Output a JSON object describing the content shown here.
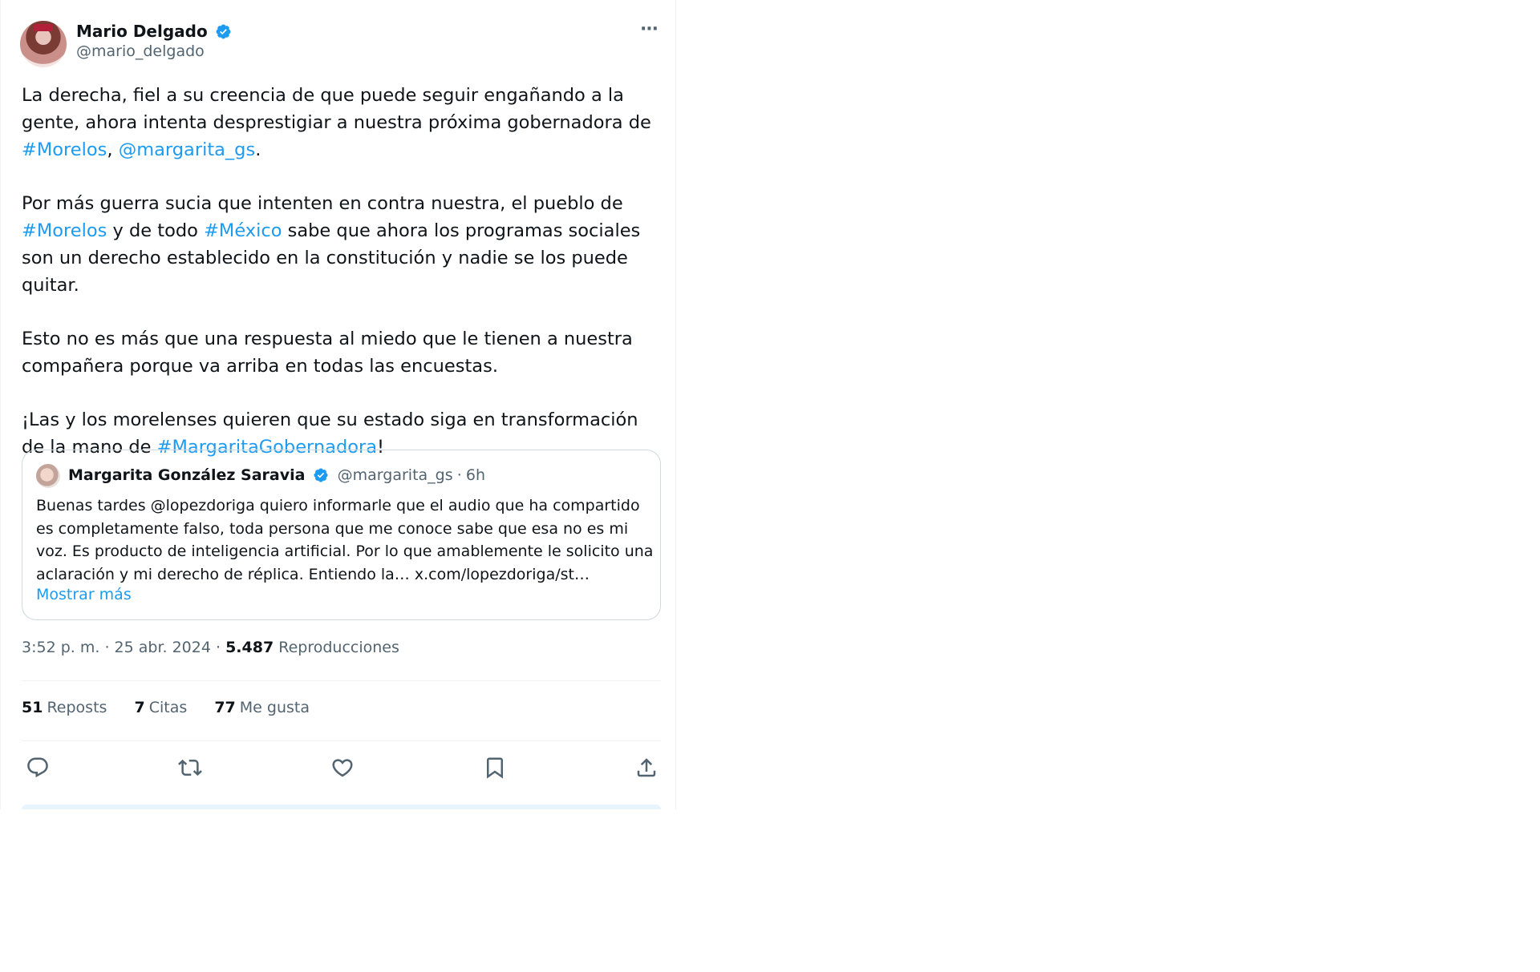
{
  "author": {
    "display_name": "Mario Delgado",
    "handle": "@mario_delgado",
    "verified": true
  },
  "menu": {
    "more_icon": "more-horizontal-icon",
    "more_glyph": "···"
  },
  "tweet": {
    "p1": {
      "t1": "La derecha, fiel a su creencia de que puede seguir engañando a la gente, ahora intenta desprestigiar a nuestra próxima gobernadora de ",
      "l1": "#Morelos",
      "t2": ", ",
      "l2": "@margarita_gs",
      "t3": "."
    },
    "p2": {
      "t1": "Por más guerra sucia que intenten en contra nuestra, el pueblo de ",
      "l1": "#Morelos",
      "t2": " y de todo ",
      "l2": "#México",
      "t3": " sabe que ahora los programas sociales son un derecho establecido en la constitución y nadie se los puede quitar."
    },
    "p3": {
      "t1": "Esto no es más que una respuesta al miedo que le tienen a nuestra compañera porque va arriba en todas las encuestas."
    },
    "p4": {
      "t1": "¡Las y los morelenses quieren que su estado siga en transformación de la mano de ",
      "l1": "#MargaritaGobernadora",
      "t2": "!"
    }
  },
  "quote": {
    "display_name": "Margarita González Saravia",
    "handle": "@margarita_gs",
    "separator": "·",
    "time": "6h",
    "text": "Buenas tardes @lopezdoriga quiero informarle que el audio que ha compartido es completamente falso, toda persona que me conoce sabe que esa no es mi voz. Es producto de inteligencia artificial. Por lo que amablemente le solicito una aclaración y mi derecho de réplica. Entiendo la… x.com/lopezdoriga/st…",
    "show_more": "Mostrar más"
  },
  "meta": {
    "time": "3:52 p. m.",
    "sep1": " · ",
    "date": "25 abr. 2024",
    "sep2": " · ",
    "views_count": "5.487",
    "views_label": " Reproducciones"
  },
  "stats": {
    "reposts_count": "51",
    "reposts_label": "Reposts",
    "quotes_count": "7",
    "quotes_label": "Citas",
    "likes_count": "77",
    "likes_label": "Me gusta"
  },
  "actions": {
    "icons": [
      "reply-icon",
      "repost-icon",
      "like-icon",
      "bookmark-icon",
      "share-icon"
    ]
  },
  "colors": {
    "link": "#1d9bf0",
    "text": "#0f1419",
    "secondary": "#536471",
    "border": "#cfd9de"
  }
}
